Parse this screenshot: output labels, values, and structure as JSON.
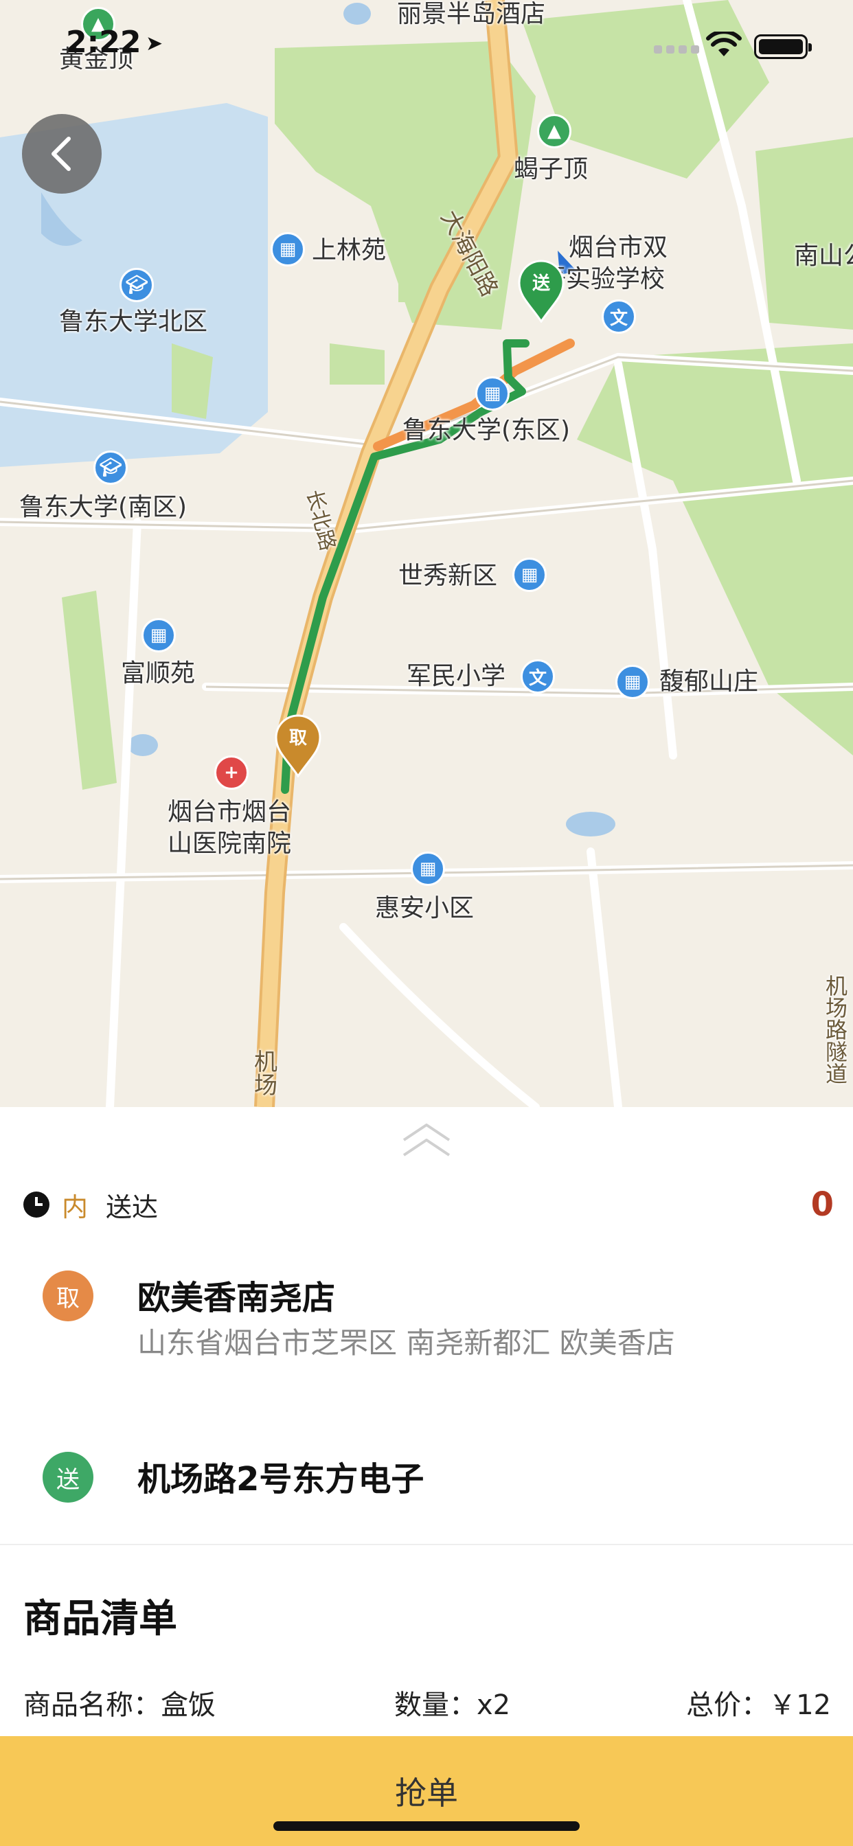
{
  "status_bar": {
    "time": "2:22",
    "location_icon": "location-arrow-icon",
    "wifi_icon": "wifi-icon",
    "battery_icon": "battery-icon"
  },
  "map": {
    "labels": {
      "lijing": "丽景半岛酒店",
      "huangjinding": "黄金顶",
      "xiezi": "蝎子顶",
      "shanglin": "上林苑",
      "ludong_north": "鲁东大学北区",
      "dahaiyang": "大海阳路",
      "school_line1": "烟台市双",
      "school_line2": "语实验学校",
      "nanshan": "南山公",
      "ludong_east": "鲁东大学(东区)",
      "ludong_south": "鲁东大学(南区)",
      "shixiu": "世秀新区",
      "fushun": "富顺苑",
      "junmin": "军民小学",
      "fuyu": "馥郁山庄",
      "hospital_line1": "烟台市烟台",
      "hospital_line2": "山医院南院",
      "huian": "惠安小区",
      "jichang": "机场",
      "road_v": "机场路隧道",
      "road_small": "长北路"
    },
    "pickup_pin": "取",
    "dropoff_pin": "送",
    "colors": {
      "route": "#2e9c4b",
      "traffic": "#f2954a",
      "main_road": "#f4c77e",
      "green": "#c6e3a6",
      "water": "#c9dff0"
    }
  },
  "panel": {
    "time_inner": "内",
    "time_deliver": "送达",
    "amount": "0",
    "pickup": {
      "badge": "取",
      "name": "欧美香南尧店",
      "address": "山东省烟台市芝罘区 南尧新都汇 欧美香店"
    },
    "dropoff": {
      "badge": "送",
      "name": "机场路2号东方电子"
    },
    "goods": {
      "title": "商品清单",
      "name_label": "商品名称：盒饭",
      "qty_label": "数量：x2",
      "price_label": "总价：￥12"
    },
    "grab_button": "抢单"
  }
}
